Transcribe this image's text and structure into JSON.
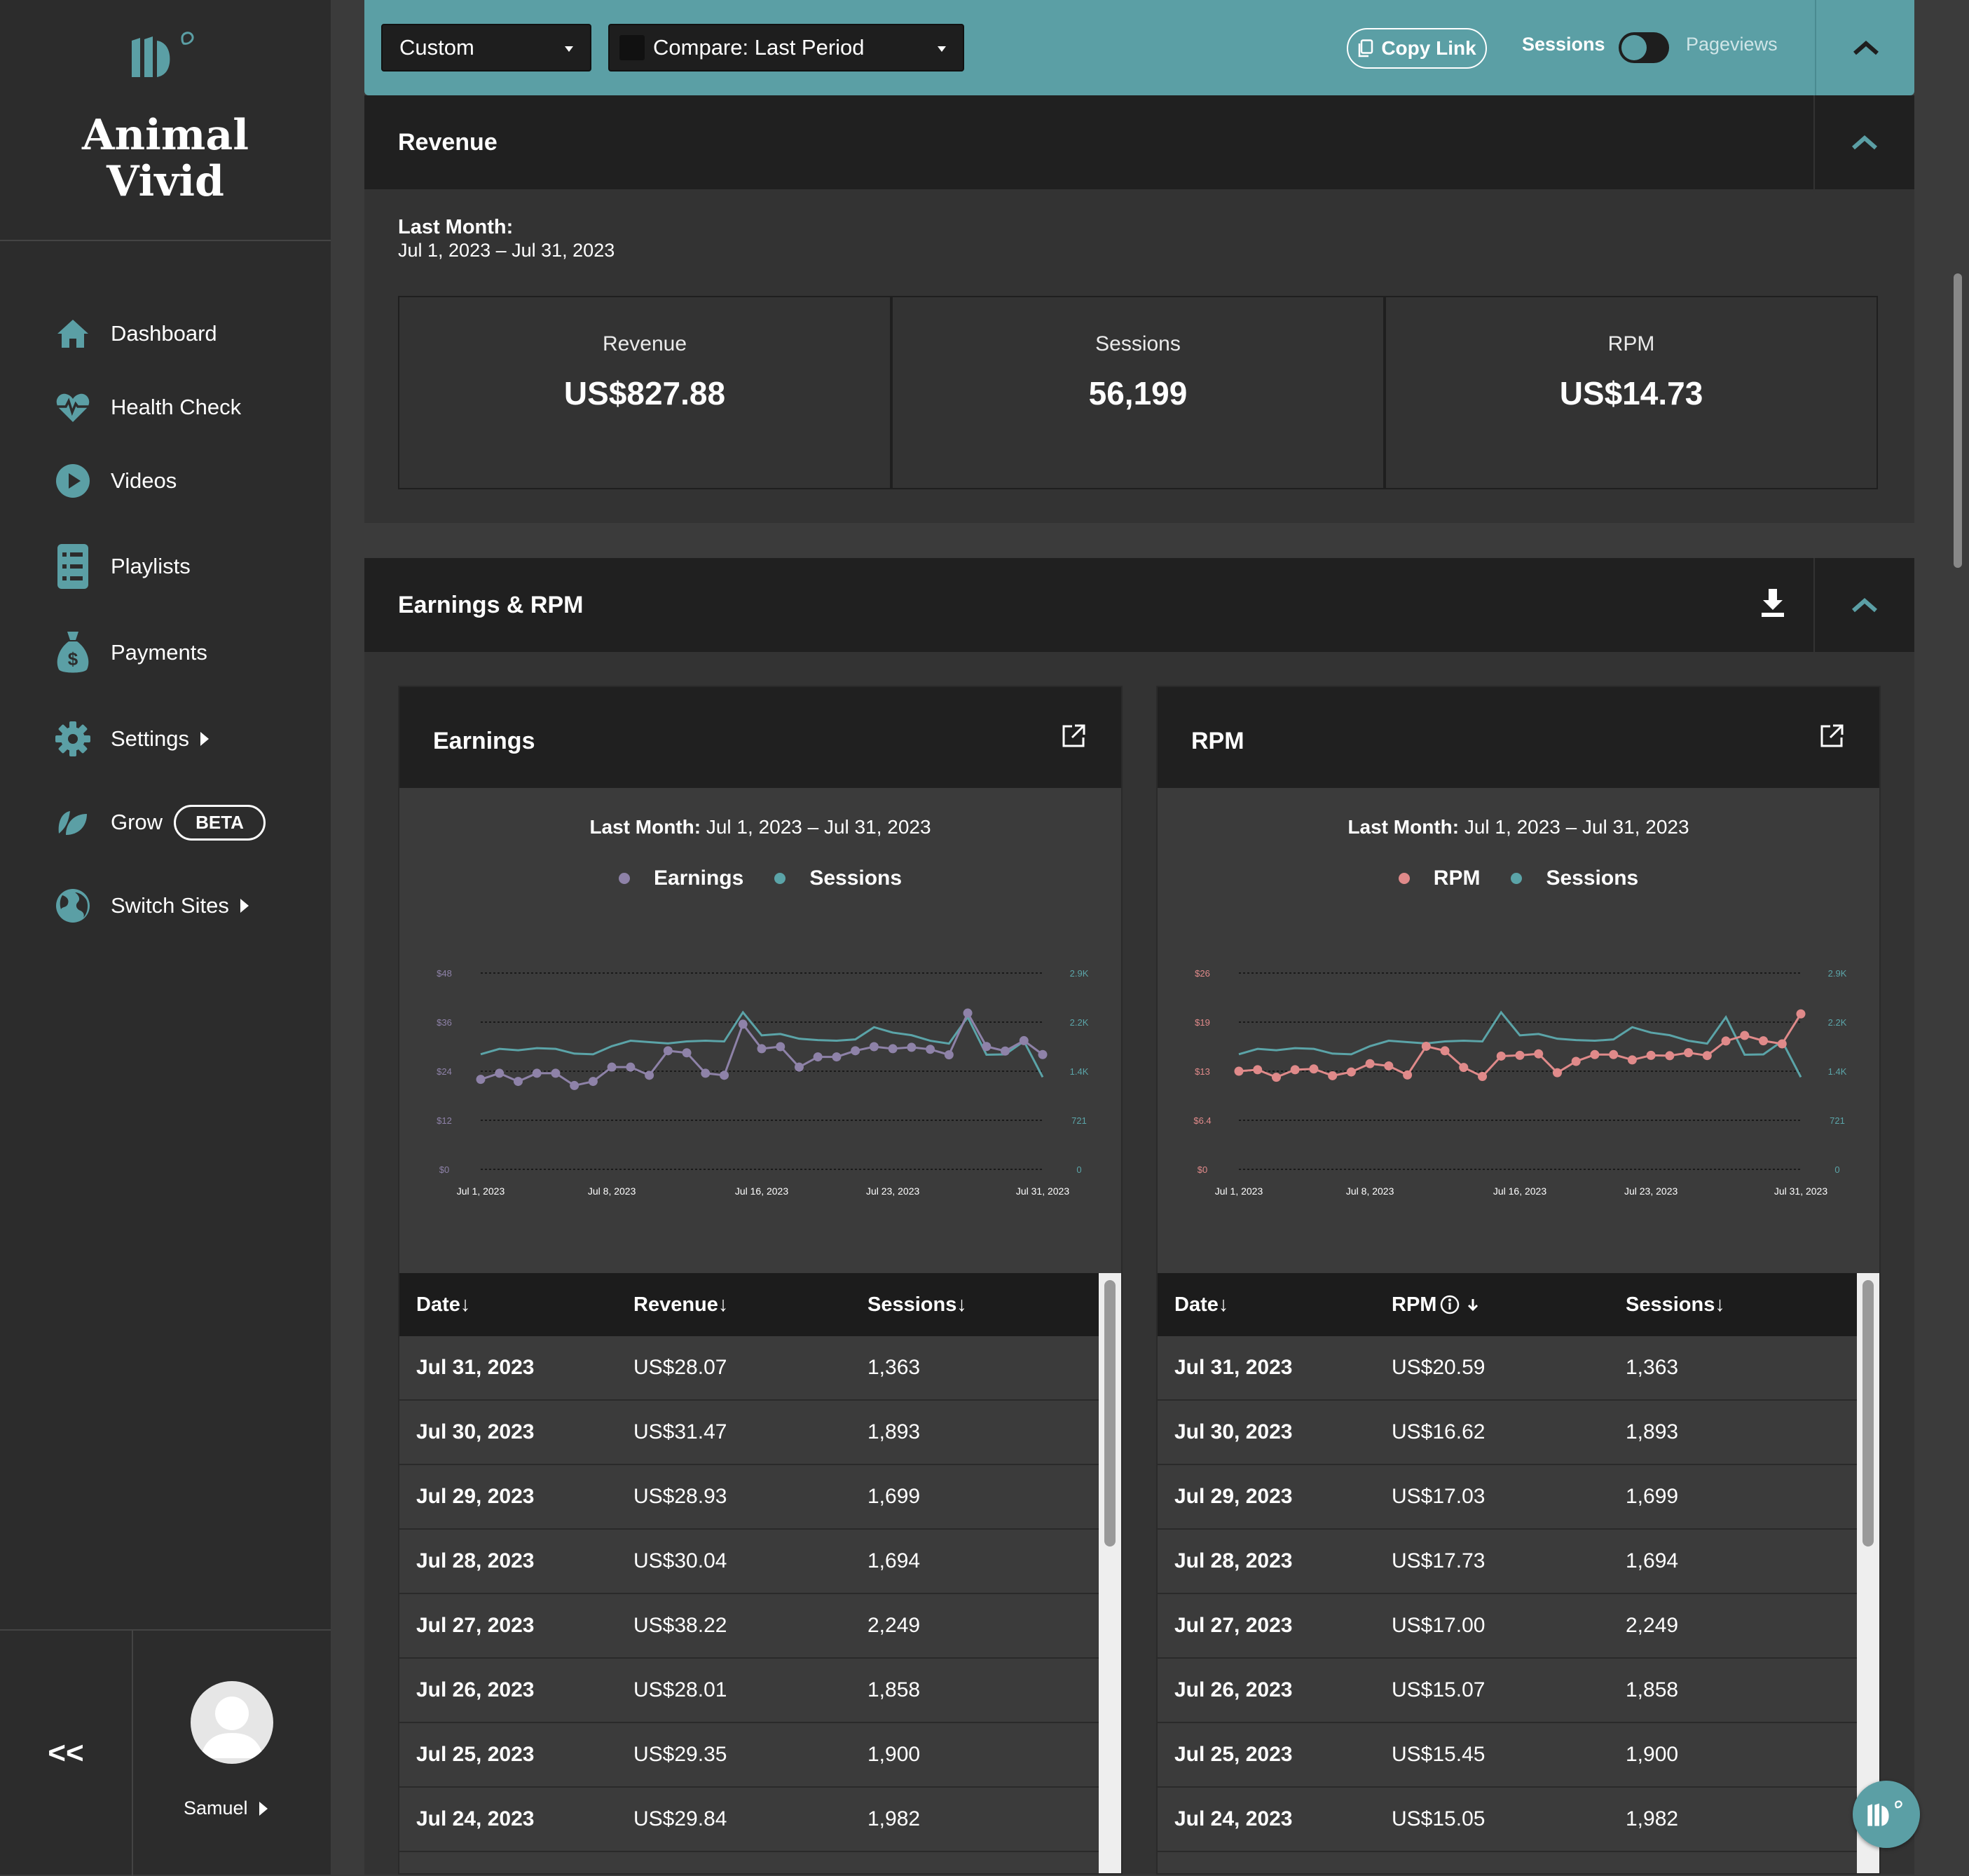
{
  "brand": {
    "name_line1": "Animal",
    "name_line2": "Vivid",
    "accent": "#5b9fa5"
  },
  "sidebar": {
    "items": [
      {
        "label": "Dashboard",
        "icon": "home-icon"
      },
      {
        "label": "Health Check",
        "icon": "heartbeat-icon"
      },
      {
        "label": "Videos",
        "icon": "play-circle-icon"
      },
      {
        "label": "Playlists",
        "icon": "list-icon"
      },
      {
        "label": "Payments",
        "icon": "money-bag-icon"
      },
      {
        "label": "Settings",
        "icon": "gear-icon"
      },
      {
        "label": "Grow",
        "icon": "leaf-icon",
        "badge": "BETA"
      },
      {
        "label": "Switch Sites",
        "icon": "globe-icon"
      }
    ],
    "collapse_label": "<<",
    "user": "Samuel"
  },
  "toolbar": {
    "date_select": "Custom",
    "compare_select": "Compare: Last Period",
    "copy_link": "Copy Link",
    "toggle_left": "Sessions",
    "toggle_right": "Pageviews"
  },
  "revenue": {
    "title": "Revenue",
    "period_label": "Last Month:",
    "period_range": "Jul 1, 2023 – Jul 31, 2023",
    "stats": [
      {
        "label": "Revenue",
        "value": "US$827.88"
      },
      {
        "label": "Sessions",
        "value": "56,199"
      },
      {
        "label": "RPM",
        "value": "US$14.73"
      }
    ]
  },
  "earnings_rpm": {
    "title": "Earnings & RPM",
    "earnings_card": {
      "title": "Earnings",
      "period_label": "Last Month:",
      "period_range": "Jul 1, 2023 – Jul 31, 2023",
      "legend": [
        "Earnings",
        "Sessions"
      ],
      "table": {
        "headers": [
          "Date↓",
          "Revenue↓",
          "Sessions↓"
        ],
        "rows": [
          [
            "Jul 31, 2023",
            "US$28.07",
            "1,363"
          ],
          [
            "Jul 30, 2023",
            "US$31.47",
            "1,893"
          ],
          [
            "Jul 29, 2023",
            "US$28.93",
            "1,699"
          ],
          [
            "Jul 28, 2023",
            "US$30.04",
            "1,694"
          ],
          [
            "Jul 27, 2023",
            "US$38.22",
            "2,249"
          ],
          [
            "Jul 26, 2023",
            "US$28.01",
            "1,858"
          ],
          [
            "Jul 25, 2023",
            "US$29.35",
            "1,900"
          ],
          [
            "Jul 24, 2023",
            "US$29.84",
            "1,982"
          ]
        ]
      }
    },
    "rpm_card": {
      "title": "RPM",
      "period_label": "Last Month:",
      "period_range": "Jul 1, 2023 – Jul 31, 2023",
      "legend": [
        "RPM",
        "Sessions"
      ],
      "table": {
        "headers": [
          "Date↓",
          "RPM",
          "Sessions↓"
        ],
        "rows": [
          [
            "Jul 31, 2023",
            "US$20.59",
            "1,363"
          ],
          [
            "Jul 30, 2023",
            "US$16.62",
            "1,893"
          ],
          [
            "Jul 29, 2023",
            "US$17.03",
            "1,699"
          ],
          [
            "Jul 28, 2023",
            "US$17.73",
            "1,694"
          ],
          [
            "Jul 27, 2023",
            "US$17.00",
            "2,249"
          ],
          [
            "Jul 26, 2023",
            "US$15.07",
            "1,858"
          ],
          [
            "Jul 25, 2023",
            "US$15.45",
            "1,900"
          ],
          [
            "Jul 24, 2023",
            "US$15.05",
            "1,982"
          ]
        ]
      }
    }
  },
  "chart_data": [
    {
      "type": "line",
      "x": [
        "Jul 1, 2023",
        "Jul 2, 2023",
        "Jul 3, 2023",
        "Jul 4, 2023",
        "Jul 5, 2023",
        "Jul 6, 2023",
        "Jul 7, 2023",
        "Jul 8, 2023",
        "Jul 9, 2023",
        "Jul 10, 2023",
        "Jul 11, 2023",
        "Jul 12, 2023",
        "Jul 13, 2023",
        "Jul 14, 2023",
        "Jul 15, 2023",
        "Jul 16, 2023",
        "Jul 17, 2023",
        "Jul 18, 2023",
        "Jul 19, 2023",
        "Jul 20, 2023",
        "Jul 21, 2023",
        "Jul 22, 2023",
        "Jul 23, 2023",
        "Jul 24, 2023",
        "Jul 25, 2023",
        "Jul 26, 2023",
        "Jul 27, 2023",
        "Jul 28, 2023",
        "Jul 29, 2023",
        "Jul 30, 2023",
        "Jul 31, 2023"
      ],
      "x_ticks": [
        "Jul 1, 2023",
        "Jul 8, 2023",
        "Jul 16, 2023",
        "Jul 23, 2023",
        "Jul 31, 2023"
      ],
      "y_left_ticks": [
        "$0",
        "$12",
        "$24",
        "$36",
        "$48"
      ],
      "y_right_ticks": [
        "0",
        "721",
        "1.4K",
        "2.2K",
        "2.9K"
      ],
      "ylim_left": [
        0,
        48
      ],
      "ylim_right": [
        0,
        2900
      ],
      "series": [
        {
          "name": "Earnings",
          "axis": "left",
          "color": "#8e82a8",
          "values": [
            22,
            23.5,
            21.5,
            23.5,
            23.5,
            20.5,
            21.5,
            25,
            25,
            23,
            29,
            28.5,
            23.5,
            23,
            35.5,
            29.5,
            30,
            25,
            27.5,
            27.5,
            29,
            30,
            29.5,
            29.84,
            29.35,
            28.01,
            38.22,
            30.04,
            28.93,
            31.47,
            28.07
          ]
        },
        {
          "name": "Sessions",
          "axis": "right",
          "color": "#5ba4a8",
          "values": [
            1700,
            1780,
            1760,
            1790,
            1780,
            1710,
            1700,
            1820,
            1900,
            1880,
            1860,
            1890,
            1900,
            1890,
            2320,
            1980,
            2000,
            1930,
            1910,
            1900,
            1920,
            2100,
            2020,
            1982,
            1900,
            1858,
            2249,
            1694,
            1699,
            1893,
            1363
          ]
        }
      ]
    },
    {
      "type": "line",
      "x": [
        "Jul 1, 2023",
        "Jul 2, 2023",
        "Jul 3, 2023",
        "Jul 4, 2023",
        "Jul 5, 2023",
        "Jul 6, 2023",
        "Jul 7, 2023",
        "Jul 8, 2023",
        "Jul 9, 2023",
        "Jul 10, 2023",
        "Jul 11, 2023",
        "Jul 12, 2023",
        "Jul 13, 2023",
        "Jul 14, 2023",
        "Jul 15, 2023",
        "Jul 16, 2023",
        "Jul 17, 2023",
        "Jul 18, 2023",
        "Jul 19, 2023",
        "Jul 20, 2023",
        "Jul 21, 2023",
        "Jul 22, 2023",
        "Jul 23, 2023",
        "Jul 24, 2023",
        "Jul 25, 2023",
        "Jul 26, 2023",
        "Jul 27, 2023",
        "Jul 28, 2023",
        "Jul 29, 2023",
        "Jul 30, 2023",
        "Jul 31, 2023"
      ],
      "x_ticks": [
        "Jul 1, 2023",
        "Jul 8, 2023",
        "Jul 16, 2023",
        "Jul 23, 2023",
        "Jul 31, 2023"
      ],
      "y_left_ticks": [
        "$0",
        "$6.4",
        "$13",
        "$19",
        "$26"
      ],
      "y_right_ticks": [
        "0",
        "721",
        "1.4K",
        "2.2K",
        "2.9K"
      ],
      "ylim_left": [
        0,
        26
      ],
      "ylim_right": [
        0,
        2900
      ],
      "series": [
        {
          "name": "RPM",
          "axis": "left",
          "color": "#e08a8a",
          "values": [
            13,
            13.2,
            12.2,
            13.2,
            13.3,
            12.4,
            12.9,
            14,
            13.7,
            12.5,
            16.3,
            15.7,
            13.5,
            12.3,
            15,
            15.1,
            15.3,
            12.8,
            14.3,
            15.2,
            15.2,
            14.5,
            15.1,
            15.05,
            15.45,
            15.07,
            17,
            17.73,
            17.03,
            16.62,
            20.59
          ]
        },
        {
          "name": "Sessions",
          "axis": "right",
          "color": "#5ba4a8",
          "values": [
            1700,
            1780,
            1760,
            1790,
            1780,
            1710,
            1700,
            1820,
            1900,
            1880,
            1860,
            1890,
            1900,
            1890,
            2320,
            1980,
            2000,
            1930,
            1910,
            1900,
            1920,
            2100,
            2020,
            1982,
            1900,
            1858,
            2249,
            1694,
            1699,
            1893,
            1363
          ]
        }
      ]
    }
  ]
}
